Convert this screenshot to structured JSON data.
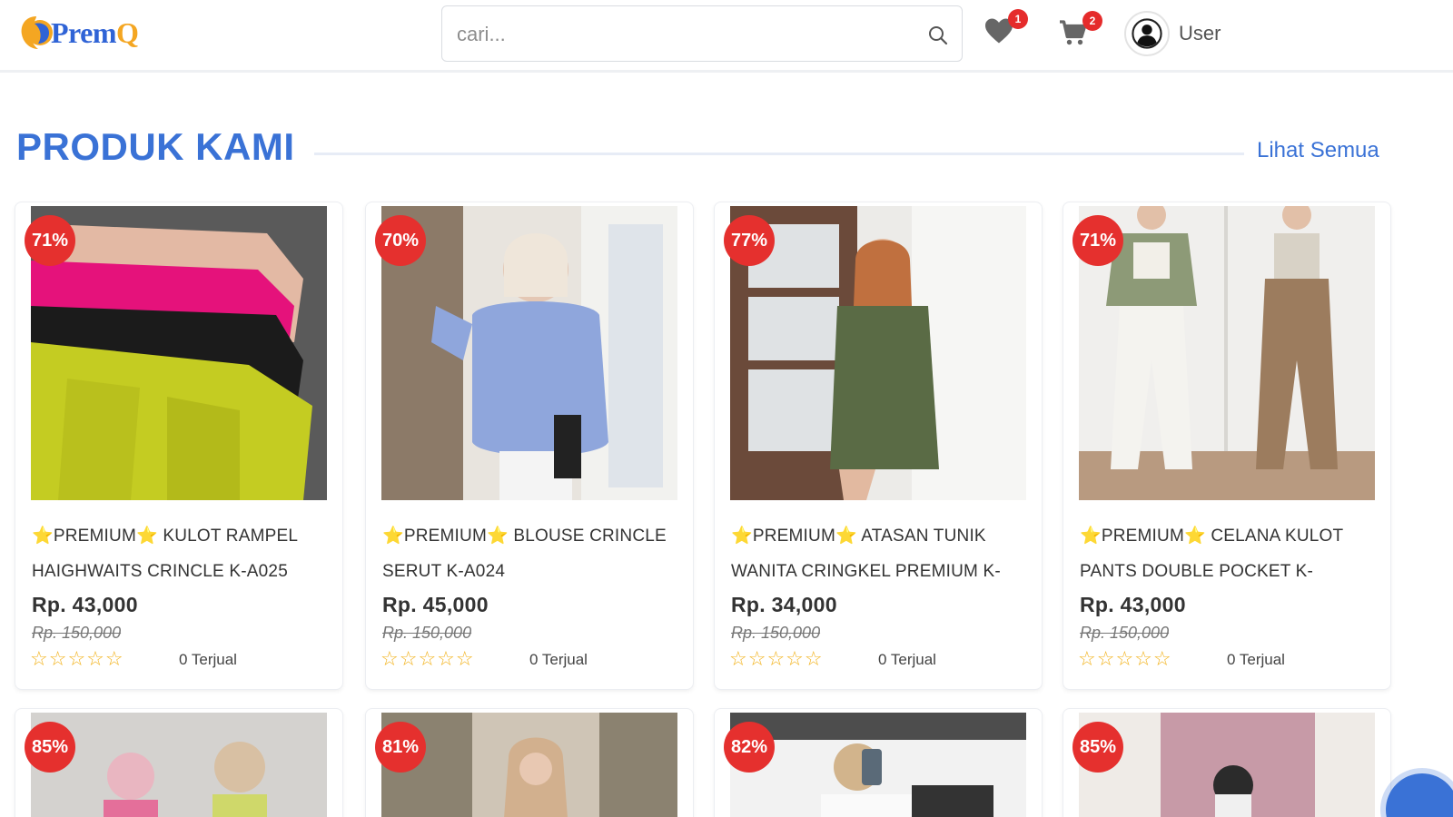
{
  "header": {
    "logo_text": "Prem",
    "logo_text_q": "Q",
    "search_placeholder": "cari...",
    "wishlist_count": "1",
    "cart_count": "2",
    "user_name": "User"
  },
  "section": {
    "title": "PRODUK KAMI",
    "see_all": "Lihat Semua"
  },
  "products": [
    {
      "discount": "71%",
      "badge_prefix": "⭐",
      "badge": "PREMIUM",
      "badge_suffix": "⭐",
      "name": " KULOT RAMPEL HAIGHWAITS CRINCLE K-A025",
      "price": "Rp. 43,000",
      "old_price": "Rp. 150,000",
      "stars": "☆☆☆☆☆",
      "sold": "0 Terjual"
    },
    {
      "discount": "70%",
      "badge_prefix": "⭐",
      "badge": "PREMIUM",
      "badge_suffix": "⭐",
      "name": " BLOUSE CRINCLE SERUT K-A024",
      "price": "Rp. 45,000",
      "old_price": "Rp. 150,000",
      "stars": "☆☆☆☆☆",
      "sold": "0 Terjual"
    },
    {
      "discount": "77%",
      "badge_prefix": "⭐",
      "badge": "PREMIUM",
      "badge_suffix": "⭐",
      "name": " ATASAN TUNIK WANITA CRINGKEL PREMIUM K-",
      "price": "Rp. 34,000",
      "old_price": "Rp. 150,000",
      "stars": "☆☆☆☆☆",
      "sold": "0 Terjual"
    },
    {
      "discount": "71%",
      "badge_prefix": "⭐",
      "badge": "PREMIUM",
      "badge_suffix": "⭐",
      "name": " CELANA KULOT PANTS DOUBLE POCKET K-",
      "price": "Rp. 43,000",
      "old_price": "Rp. 150,000",
      "stars": "☆☆☆☆☆",
      "sold": "0 Terjual"
    }
  ],
  "products_row2": [
    {
      "discount": "85%"
    },
    {
      "discount": "81%"
    },
    {
      "discount": "82%"
    },
    {
      "discount": "85%"
    }
  ],
  "colors": {
    "accent": "#3a72d6",
    "discount_badge": "#e5302e",
    "star": "#f2b21b"
  }
}
